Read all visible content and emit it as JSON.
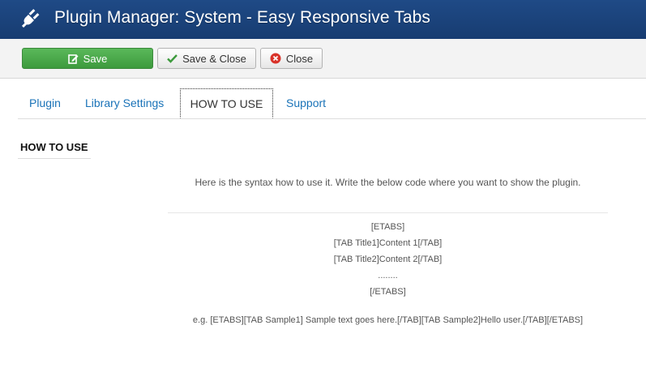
{
  "header": {
    "title": "Plugin Manager: System - Easy Responsive Tabs",
    "icon": "plug-icon"
  },
  "toolbar": {
    "save_label": "Save",
    "save_close_label": "Save & Close",
    "close_label": "Close"
  },
  "tabs": [
    {
      "label": "Plugin",
      "active": false
    },
    {
      "label": "Library Settings",
      "active": false
    },
    {
      "label": "HOW TO USE",
      "active": true
    },
    {
      "label": "Support",
      "active": false
    }
  ],
  "content": {
    "heading": "HOW TO USE",
    "intro": "Here is the syntax how to use it. Write the below code where you want to show the plugin.",
    "code_lines": [
      "[ETABS]",
      "[TAB Title1]Content 1[/TAB]",
      "[TAB Title2]Content 2[/TAB]",
      "........",
      "[/ETABS]"
    ],
    "example": "e.g. [ETABS][TAB Sample1] Sample text goes here.[/TAB][TAB Sample2]Hello user.[/TAB][/ETABS]"
  },
  "colors": {
    "header_bg": "#1f4a86",
    "save_button": "#4cae4c",
    "tab_link": "#1a73b8",
    "close_icon": "#d9332a",
    "check_icon": "#3c9a3c"
  }
}
